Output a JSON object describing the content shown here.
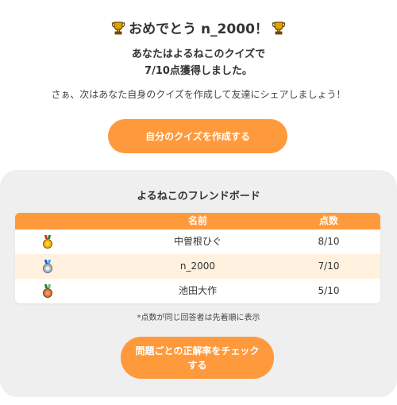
{
  "header": {
    "title": "おめでとう n_2000！",
    "result_line1": "あなたはよるねこのクイズで",
    "result_line2": "7/10点獲得しました。",
    "share_text": "さぁ、次はあなた自身のクイズを作成して友達にシェアしましょう！"
  },
  "create_button": {
    "label": "自分のクイズを作成する"
  },
  "leaderboard": {
    "title": "よるねこのフレンドボード",
    "columns": {
      "name": "名前",
      "score": "点数"
    },
    "rows": [
      {
        "medal": "gold-medal",
        "name": "中曽根ひぐ",
        "score": "8/10"
      },
      {
        "medal": "silver-medal",
        "name": "n_2000",
        "score": "7/10"
      },
      {
        "medal": "bronze-medal",
        "name": "池田大作",
        "score": "5/10"
      }
    ],
    "note": "*点数が同じ回答者は先着順に表示"
  },
  "check_button": {
    "label": "問題ごとの正解率をチェックする"
  },
  "colors": {
    "accent": "#ff9a3c",
    "alt_row": "#fff1de",
    "panel": "#efefef",
    "trophy": "#e0a100"
  }
}
